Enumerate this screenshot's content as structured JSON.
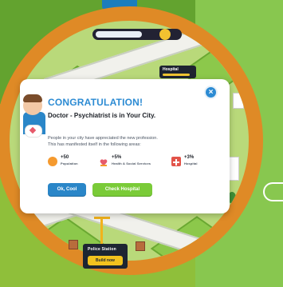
{
  "game": {
    "top_status": {
      "coin_icon": "coin-icon"
    },
    "map_tags": {
      "hospital": {
        "label": "Hospital"
      },
      "police_station": {
        "label": "Police Station",
        "button_label": "Build now"
      }
    }
  },
  "dialog": {
    "title": "Congratulation!",
    "subtitle": "Doctor - Psychiatrist is in Your City.",
    "description_lines": [
      "People in your city have appreciated the new profession.",
      "This has manifested itself in the following areas:"
    ],
    "stats": [
      {
        "icon": "population-icon",
        "value": "+50",
        "label": "Population"
      },
      {
        "icon": "health-icon",
        "value": "+5%",
        "label": "Health & Social Services"
      },
      {
        "icon": "hospital-icon",
        "value": "+3%",
        "label": "Hospital"
      }
    ],
    "buttons": {
      "ok": "Ok, Cool",
      "check": "Check Hospital"
    },
    "close_icon": "close-icon"
  },
  "colors": {
    "accent_blue": "#2c8bd3",
    "ok_button": "#2a86c8",
    "check_button": "#7acb38",
    "ring_orange": "#df8a26"
  }
}
